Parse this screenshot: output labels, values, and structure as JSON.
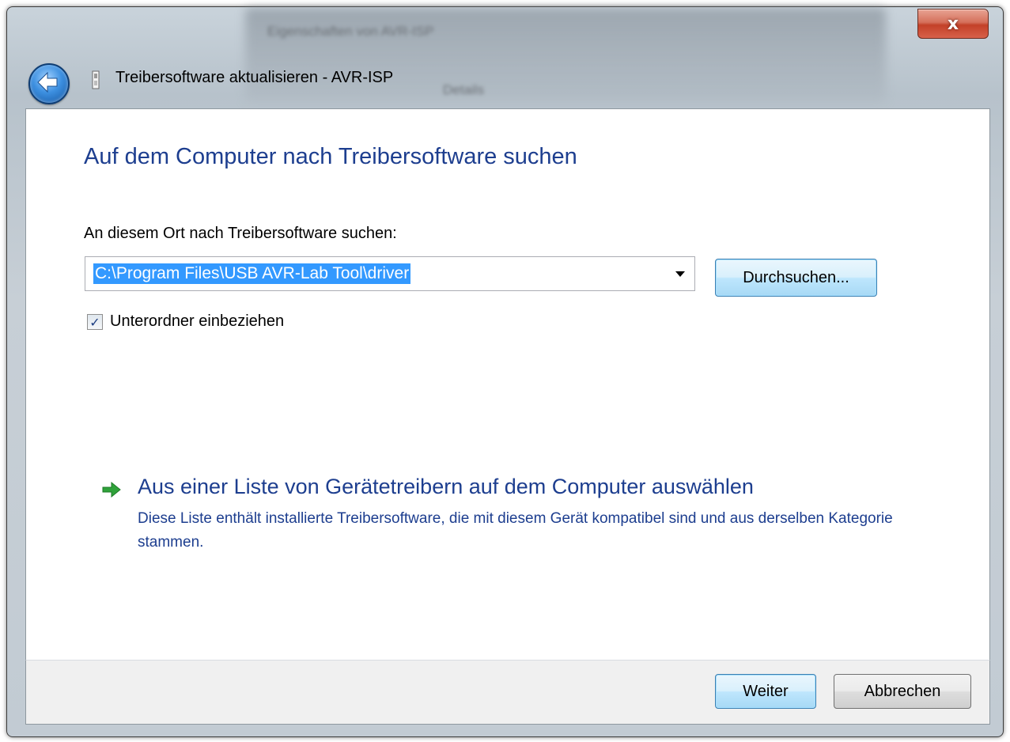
{
  "background_window": {
    "title": "Eigenschaften von AVR-ISP",
    "tab": "Details"
  },
  "titlebar": {
    "close_label": "x",
    "title": "Treibersoftware aktualisieren - AVR-ISP"
  },
  "main": {
    "heading": "Auf dem Computer nach Treibersoftware suchen",
    "location_label": "An diesem Ort nach Treibersoftware suchen:",
    "path_value": "C:\\Program Files\\USB AVR-Lab Tool\\driver",
    "browse_label": "Durchsuchen...",
    "include_subfolders_label": "Unterordner einbeziehen",
    "include_subfolders_checked": true,
    "list_link_title": "Aus einer Liste von Gerätetreibern auf dem Computer auswählen",
    "list_link_desc": "Diese Liste enthält installierte Treibersoftware, die mit diesem Gerät kompatibel sind und aus derselben Kategorie stammen."
  },
  "footer": {
    "next_label": "Weiter",
    "cancel_label": "Abbrechen"
  },
  "colors": {
    "heading": "#1d3e8f",
    "selection": "#3399ff",
    "close": "#c34128"
  }
}
